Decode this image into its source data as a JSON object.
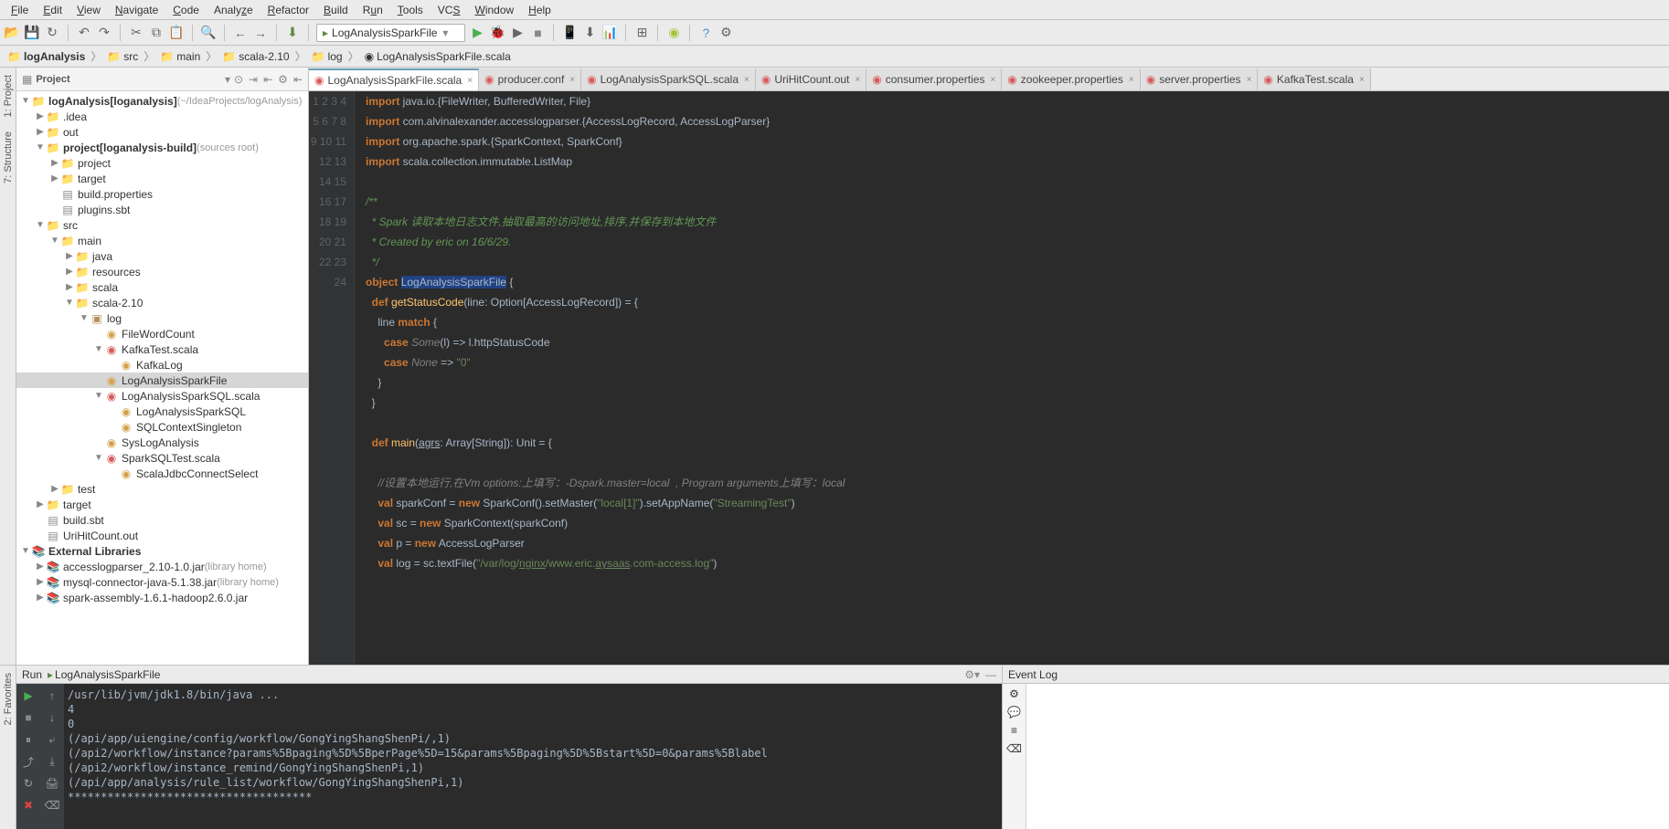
{
  "menu": [
    "File",
    "Edit",
    "View",
    "Navigate",
    "Code",
    "Analyze",
    "Refactor",
    "Build",
    "Run",
    "Tools",
    "VCS",
    "Window",
    "Help"
  ],
  "run_config": "LogAnalysisSparkFile",
  "breadcrumbs": [
    "logAnalysis",
    "src",
    "main",
    "scala-2.10",
    "log",
    "LogAnalysisSparkFile.scala"
  ],
  "panel_title": "Project",
  "sidestrip": {
    "project": "1: Project",
    "structure": "7: Structure",
    "favorites": "2: Favorites"
  },
  "tree": [
    {
      "d": 0,
      "a": "▼",
      "i": "folder-blue",
      "t": "logAnalysis",
      "suf": " [loganalysis]",
      "muted": "(~/IdeaProjects/logAnalysis)",
      "sel": false
    },
    {
      "d": 1,
      "a": "▶",
      "i": "folder",
      "t": ".idea"
    },
    {
      "d": 1,
      "a": "▶",
      "i": "folder-red",
      "t": "out"
    },
    {
      "d": 1,
      "a": "▼",
      "i": "folder-cyan",
      "t": "project",
      "suf": " [loganalysis-build]",
      "muted": "(sources root)"
    },
    {
      "d": 2,
      "a": "▶",
      "i": "folder",
      "t": "project"
    },
    {
      "d": 2,
      "a": "▶",
      "i": "folder-red",
      "t": "target"
    },
    {
      "d": 2,
      "a": "",
      "i": "file",
      "t": "build.properties"
    },
    {
      "d": 2,
      "a": "",
      "i": "file",
      "t": "plugins.sbt"
    },
    {
      "d": 1,
      "a": "▼",
      "i": "folder-blue",
      "t": "src"
    },
    {
      "d": 2,
      "a": "▼",
      "i": "folder",
      "t": "main"
    },
    {
      "d": 3,
      "a": "▶",
      "i": "folder-blue",
      "t": "java"
    },
    {
      "d": 3,
      "a": "▶",
      "i": "folder",
      "t": "resources"
    },
    {
      "d": 3,
      "a": "▶",
      "i": "folder-blue",
      "t": "scala"
    },
    {
      "d": 3,
      "a": "▼",
      "i": "folder-blue",
      "t": "scala-2.10"
    },
    {
      "d": 4,
      "a": "▼",
      "i": "pkg",
      "t": "log"
    },
    {
      "d": 5,
      "a": "",
      "i": "obj",
      "t": "FileWordCount"
    },
    {
      "d": 5,
      "a": "▼",
      "i": "scala",
      "t": "KafkaTest.scala"
    },
    {
      "d": 6,
      "a": "",
      "i": "obj",
      "t": "KafkaLog"
    },
    {
      "d": 5,
      "a": "",
      "i": "obj",
      "t": "LogAnalysisSparkFile",
      "sel": true
    },
    {
      "d": 5,
      "a": "▼",
      "i": "scala",
      "t": "LogAnalysisSparkSQL.scala"
    },
    {
      "d": 6,
      "a": "",
      "i": "obj",
      "t": "LogAnalysisSparkSQL"
    },
    {
      "d": 6,
      "a": "",
      "i": "obj",
      "t": "SQLContextSingleton"
    },
    {
      "d": 5,
      "a": "",
      "i": "obj",
      "t": "SysLogAnalysis"
    },
    {
      "d": 5,
      "a": "▼",
      "i": "scala",
      "t": "SparkSQLTest.scala"
    },
    {
      "d": 6,
      "a": "",
      "i": "obj",
      "t": "ScalaJdbcConnectSelect"
    },
    {
      "d": 2,
      "a": "▶",
      "i": "folder",
      "t": "test"
    },
    {
      "d": 1,
      "a": "▶",
      "i": "folder-red",
      "t": "target"
    },
    {
      "d": 1,
      "a": "",
      "i": "file",
      "t": "build.sbt"
    },
    {
      "d": 1,
      "a": "",
      "i": "file",
      "t": "UriHitCount.out"
    },
    {
      "d": 0,
      "a": "▼",
      "i": "lib",
      "t": "External Libraries"
    },
    {
      "d": 1,
      "a": "▶",
      "i": "lib",
      "t": "accesslogparser_2.10-1.0.jar",
      "muted": "(library home)"
    },
    {
      "d": 1,
      "a": "▶",
      "i": "lib",
      "t": "mysql-connector-java-5.1.38.jar",
      "muted": "(library home)"
    },
    {
      "d": 1,
      "a": "▶",
      "i": "lib",
      "t": "spark-assembly-1.6.1-hadoop2.6.0.jar"
    }
  ],
  "tabs": [
    {
      "label": "LogAnalysisSparkFile.scala",
      "active": true
    },
    {
      "label": "producer.conf"
    },
    {
      "label": "LogAnalysisSparkSQL.scala"
    },
    {
      "label": "UriHitCount.out"
    },
    {
      "label": "consumer.properties"
    },
    {
      "label": "zookeeper.properties"
    },
    {
      "label": "server.properties"
    },
    {
      "label": "KafkaTest.scala"
    }
  ],
  "code_lines": 24,
  "run_tool": {
    "header": "Run",
    "config": "LogAnalysisSparkFile"
  },
  "console_lines": [
    "/usr/lib/jvm/jdk1.8/bin/java ...",
    "4",
    "0",
    "(/api/app/uiengine/config/workflow/GongYingShangShenPi/,1)",
    "(/api2/workflow/instance?params%5Bpaging%5D%5BperPage%5D=15&params%5Bpaging%5D%5Bstart%5D=0&params%5Blabel",
    "(/api2/workflow/instance_remind/GongYingShangShenPi,1)",
    "(/api/app/analysis/rule_list/workflow/GongYingShangShenPi,1)",
    "*************************************"
  ],
  "event_log": "Event Log"
}
